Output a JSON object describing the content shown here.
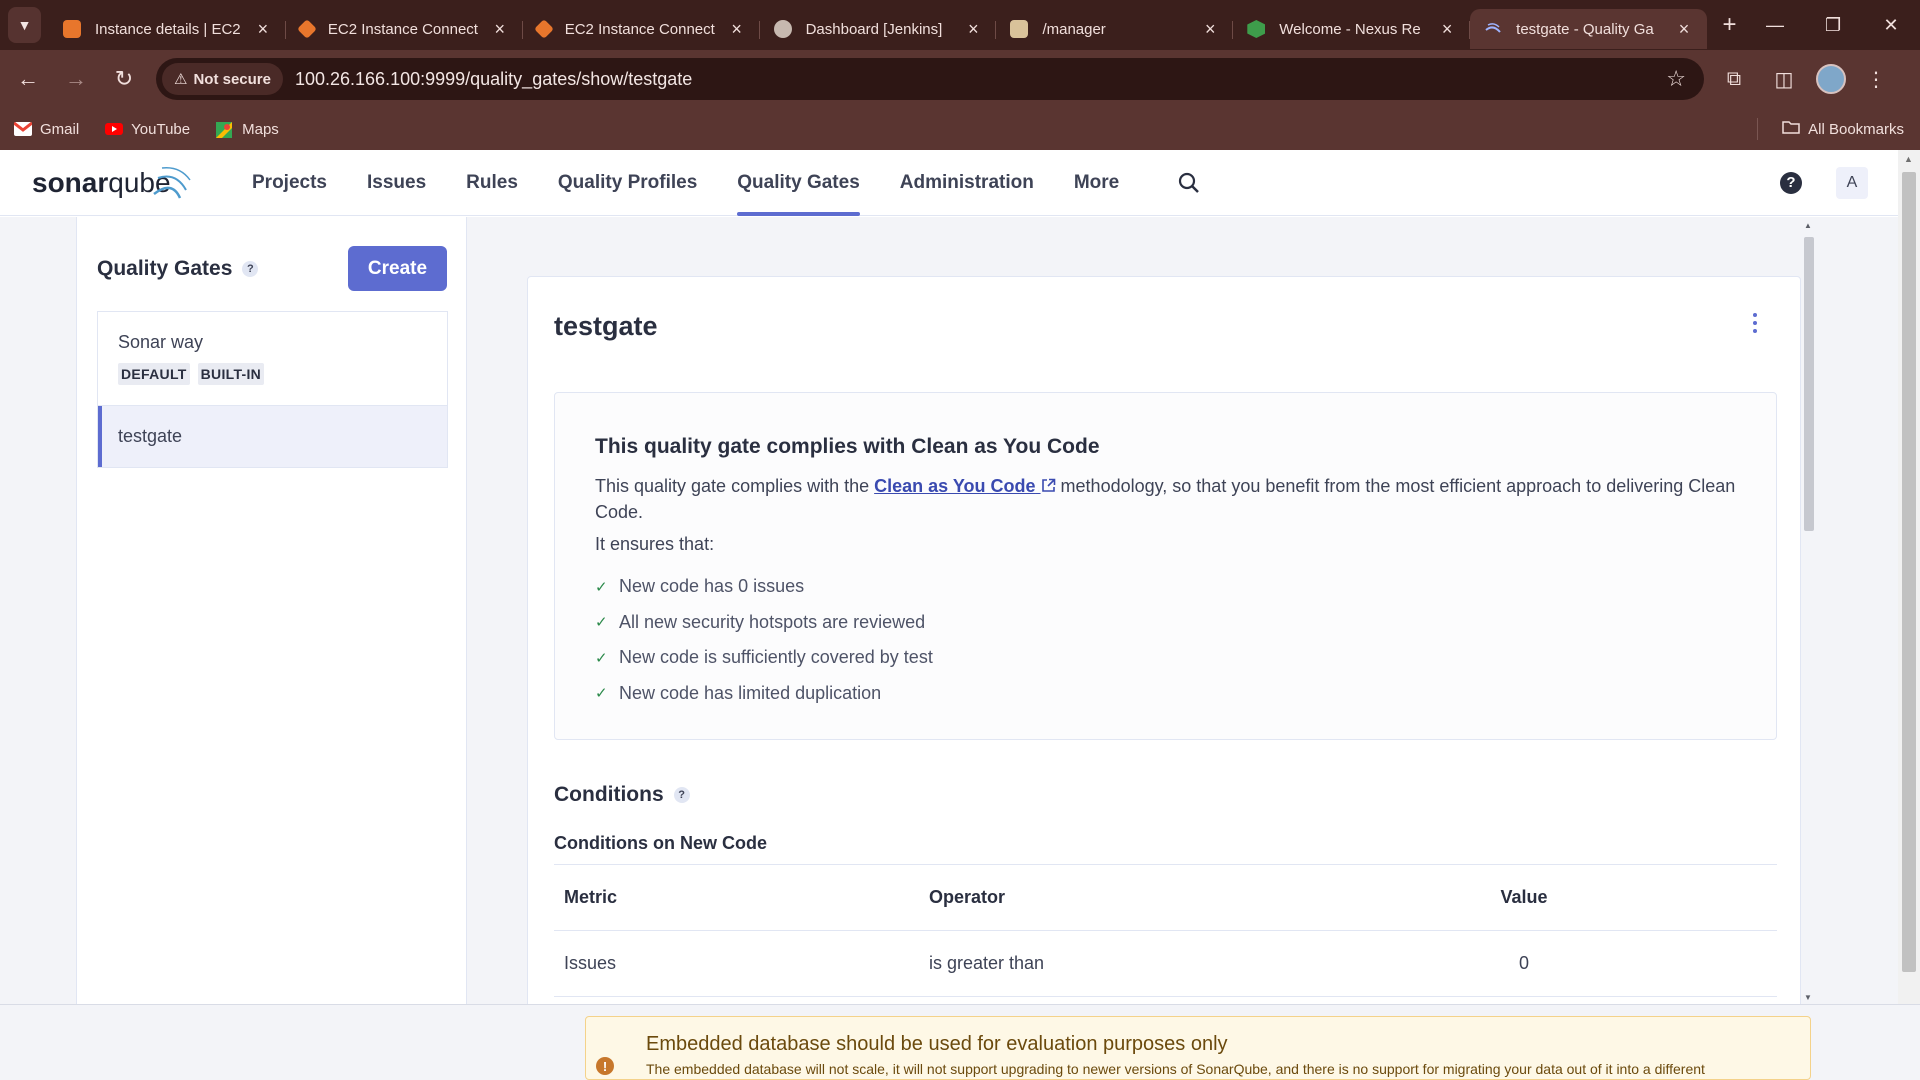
{
  "browser": {
    "tabs": [
      {
        "title": "Instance details | EC2",
        "favicon_color": "#e8762c",
        "active": false
      },
      {
        "title": "EC2 Instance Connect",
        "favicon_color": "#e8762c",
        "active": false
      },
      {
        "title": "EC2 Instance Connect",
        "favicon_color": "#e8762c",
        "active": false
      },
      {
        "title": "Dashboard [Jenkins]",
        "favicon_color": "#c7b9b0",
        "active": false
      },
      {
        "title": "/manager",
        "favicon_color": "#d9c29a",
        "active": false
      },
      {
        "title": "Welcome - Nexus Re",
        "favicon_color": "#3e9d4b",
        "active": false
      },
      {
        "title": "testgate - Quality Ga",
        "favicon_color": "#5d6cd0",
        "active": true
      }
    ],
    "security_label": "Not secure",
    "url": "100.26.166.100:9999/quality_gates/show/testgate",
    "bookmarks": [
      {
        "label": "Gmail",
        "icon": "gmail-icon"
      },
      {
        "label": "YouTube",
        "icon": "youtube-icon"
      },
      {
        "label": "Maps",
        "icon": "maps-icon"
      }
    ],
    "all_bookmarks_label": "All Bookmarks"
  },
  "app": {
    "logo_text_bold": "sonar",
    "logo_text_light": "qube",
    "nav": [
      "Projects",
      "Issues",
      "Rules",
      "Quality Profiles",
      "Quality Gates",
      "Administration",
      "More"
    ],
    "active_nav": "Quality Gates",
    "avatar_letter": "A",
    "help_glyph": "?"
  },
  "sidebar": {
    "title": "Quality Gates",
    "create_label": "Create",
    "gates": [
      {
        "name": "Sonar way",
        "tags": [
          "DEFAULT",
          "BUILT-IN"
        ],
        "selected": false
      },
      {
        "name": "testgate",
        "tags": [],
        "selected": true
      }
    ]
  },
  "gate": {
    "name": "testgate",
    "cayc": {
      "title": "This quality gate complies with Clean as You Code",
      "desc_before": "This quality gate complies with the ",
      "link": "Clean as You Code",
      "desc_after": " methodology, so that you benefit from the most efficient approach to delivering Clean Code.",
      "ensures": "It ensures that:",
      "items": [
        "New code has 0 issues",
        "All new security hotspots are reviewed",
        "New code is sufficiently covered by test",
        "New code has limited duplication"
      ]
    },
    "conditions": {
      "title": "Conditions",
      "subtitle": "Conditions on New Code",
      "headers": {
        "metric": "Metric",
        "operator": "Operator",
        "value": "Value"
      },
      "rows": [
        {
          "metric": "Issues",
          "operator": "is greater than",
          "value": "0"
        }
      ]
    }
  },
  "warning": {
    "title": "Embedded database should be used for evaluation purposes only",
    "text": "The embedded database will not scale, it will not support upgrading to newer versions of SonarQube, and there is no support for migrating your data out of it into a different"
  }
}
